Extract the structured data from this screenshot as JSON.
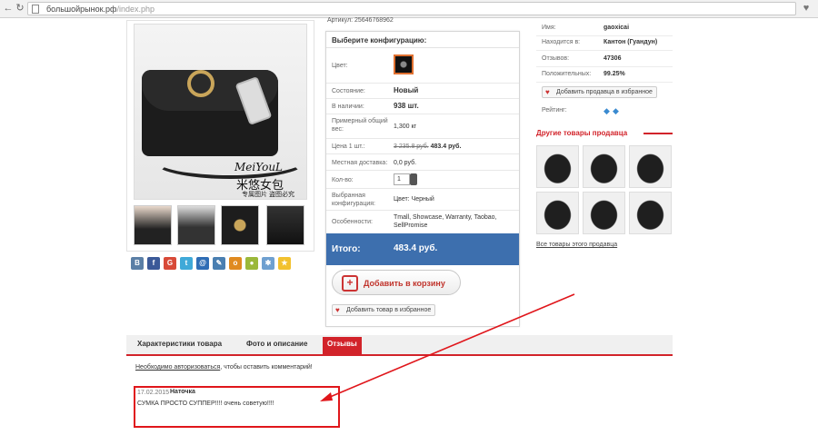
{
  "browser": {
    "url_host": "большойрынок.рф",
    "url_path": "/index.php",
    "back_icon": "arrow-left-icon",
    "forward_icon": "arrow-right-icon",
    "refresh_icon": "refresh-icon",
    "favorite_icon": "heart-icon"
  },
  "product": {
    "articul": "Артикул: 25646768962",
    "photo_caption_1": "MeiYouL",
    "photo_caption_2": "米悠女包",
    "photo_caption_3": "专属图片 盗图必究",
    "share_icons": [
      "vk",
      "facebook",
      "google-plus",
      "twitter",
      "mail",
      "livejournal",
      "odnoklassniki",
      "moi-mir",
      "yandex",
      "bookmark"
    ]
  },
  "config": {
    "header": "Выберите конфигурацию:",
    "rows": [
      {
        "label": "Цвет:",
        "value": ""
      },
      {
        "label": "Состояние:",
        "value": "Новый"
      },
      {
        "label": "В наличии:",
        "value": "938 шт."
      },
      {
        "label": "Примерный общий вес:",
        "value": "1,300 кг"
      },
      {
        "label": "Цена 1 шт.:",
        "old_price": "3 235.8 руб.",
        "value": "483.4 руб."
      },
      {
        "label": "Местная доставка:",
        "value": "0,0 руб."
      },
      {
        "label": "Кол-во:",
        "value": "1"
      },
      {
        "label": "Выбранная конфигурация:",
        "value": "Цвет: Черный"
      },
      {
        "label": "Особенности:",
        "value": "Tmall, Showcase, Warranty, Taobao, SellPromise"
      }
    ],
    "total_label": "Итого:",
    "total_value": "483.4 руб.",
    "cart_button": "Добавить в корзину",
    "fav_button": "Добавить товар в избранное"
  },
  "seller": {
    "rows": [
      {
        "label": "Имя:",
        "value": "gaoxicai"
      },
      {
        "label": "Находится в:",
        "value": "Кантон (Гуандун)"
      },
      {
        "label": "Отзывов:",
        "value": "47306"
      },
      {
        "label": "Положительных:",
        "value": "99.25%"
      }
    ],
    "fav_button": "Добавить продавца в избранное",
    "rating_label": "Рейтинг:",
    "rating_icon": "diamond-icon"
  },
  "other": {
    "title": "Другие товары продавца",
    "all_link": "Все товары этого продавца"
  },
  "tabs": [
    {
      "label": "Характеристики товара"
    },
    {
      "label": "Фото и описание"
    },
    {
      "label": "Отзывы",
      "active": true
    }
  ],
  "comments": {
    "auth_link": "Необходимо авторизоваться",
    "auth_rest": ", чтобы оставить комментарий!",
    "review": {
      "date": "17.02.2015",
      "author": "Наточка",
      "text": "СУМКА ПРОСТО СУППЕР!!!! очень советую!!!!"
    }
  },
  "colors": {
    "accent_red": "#d2232a",
    "total_blue": "#3d6fae",
    "annotation_red": "#e0161b"
  }
}
